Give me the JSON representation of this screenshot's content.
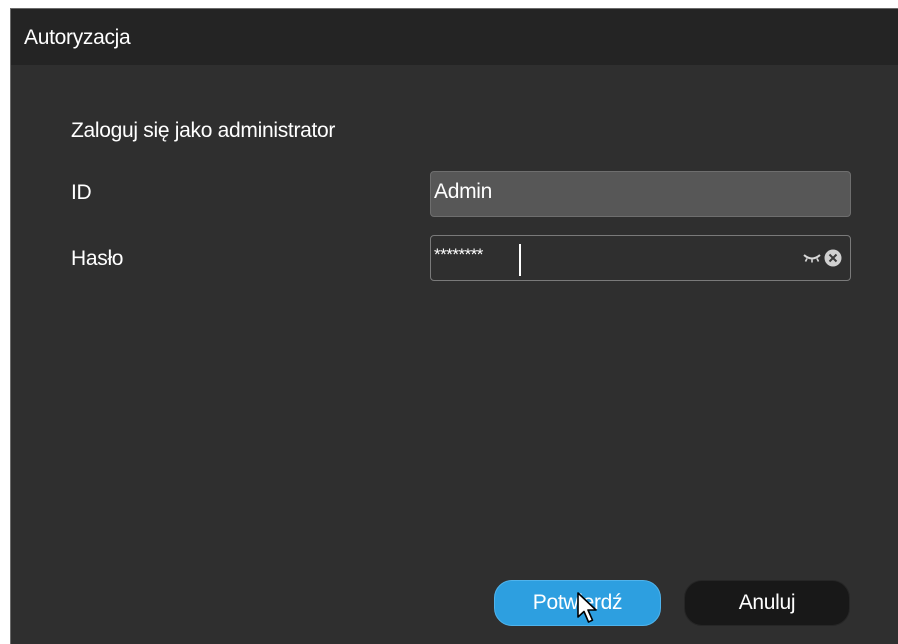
{
  "dialog": {
    "title": "Autoryzacja",
    "heading": "Zaloguj się jako administrator"
  },
  "form": {
    "id_label": "ID",
    "id_value": "Admin",
    "password_label": "Hasło",
    "password_value": "********"
  },
  "buttons": {
    "confirm_label": "Potwierdź",
    "cancel_label": "Anuluj"
  },
  "icons": {
    "show_password": "eye-closed-icon",
    "clear_field": "clear-icon",
    "pointer": "mouse-cursor-icon"
  },
  "colors": {
    "dialog_background": "#2f2f2f",
    "titlebar_background": "#242424",
    "accent_button": "#2d9fe0",
    "secondary_button": "#181818"
  }
}
